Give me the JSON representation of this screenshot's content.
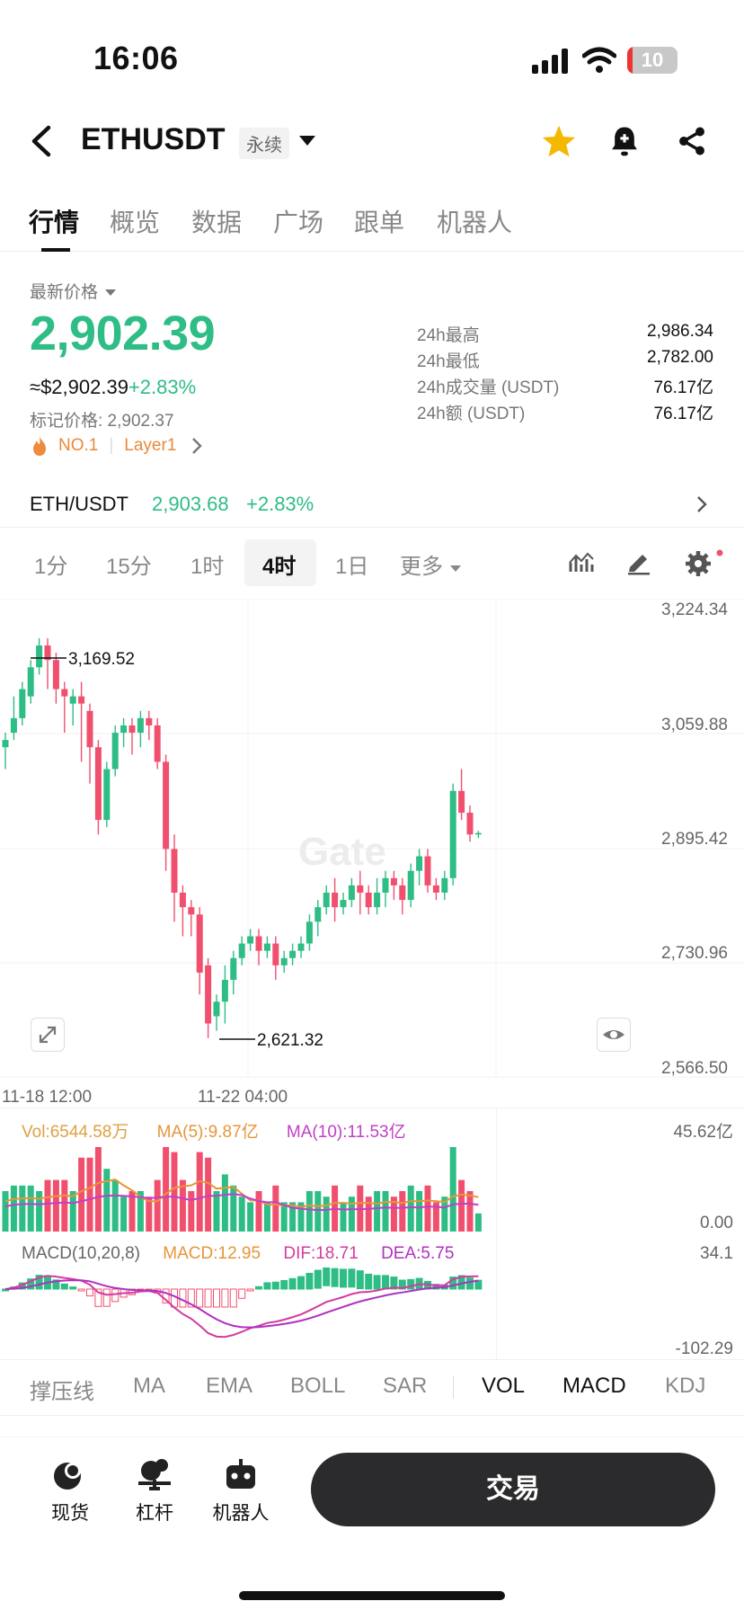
{
  "status_bar": {
    "time": "16:06",
    "battery": "10"
  },
  "header": {
    "back_icon": "back-chevron-icon",
    "symbol": "ETHUSDT",
    "contract_tag": "永续",
    "favorite_icon": "star-icon",
    "alert_icon": "bell-plus-icon",
    "share_icon": "share-icon",
    "favorite_color": "#f5b800"
  },
  "tabs": [
    {
      "label": "行情",
      "active": true
    },
    {
      "label": "概览",
      "active": false
    },
    {
      "label": "数据",
      "active": false
    },
    {
      "label": "广场",
      "active": false
    },
    {
      "label": "跟单",
      "active": false
    },
    {
      "label": "机器人",
      "active": false
    }
  ],
  "price": {
    "label": "最新价格",
    "last": "2,902.39",
    "usd": "≈$2,902.39",
    "change": "+2.83%",
    "mark_price": "标记价格: 2,902.37",
    "rank_tag": "NO.1",
    "category_tag": "Layer1"
  },
  "stats": [
    {
      "label": "24h最高",
      "value": "2,986.34"
    },
    {
      "label": "24h最低",
      "value": "2,782.00"
    },
    {
      "label": "24h成交量 (USDT)",
      "value": "76.17亿"
    },
    {
      "label": "24h额 (USDT)",
      "value": "76.17亿"
    }
  ],
  "spot_pair": {
    "pair": "ETH/USDT",
    "price": "2,903.68",
    "change": "+2.83%"
  },
  "intervals": [
    {
      "label": "1分",
      "selected": false
    },
    {
      "label": "15分",
      "selected": false
    },
    {
      "label": "1时",
      "selected": false
    },
    {
      "label": "4时",
      "selected": true
    },
    {
      "label": "1日",
      "selected": false
    },
    {
      "label": "更多",
      "selected": false
    }
  ],
  "chart_data": {
    "type": "candlestick",
    "timeframe": "4时",
    "price_axis": [
      "3,224.34",
      "3,059.88",
      "2,895.42",
      "2,730.96",
      "2,566.50"
    ],
    "ylim": [
      2566.5,
      3224.34
    ],
    "time_axis": [
      "11-18 12:00",
      "11-22 04:00"
    ],
    "high_marker": "3,169.52",
    "low_marker": "2,621.32",
    "watermark": "Gate",
    "colors": {
      "up": "#2ebd85",
      "down": "#f0506e"
    },
    "candles": [
      [
        3020,
        3030,
        2990,
        3040
      ],
      [
        3040,
        3060,
        3030,
        3090
      ],
      [
        3060,
        3100,
        3050,
        3110
      ],
      [
        3090,
        3130,
        3080,
        3140
      ],
      [
        3130,
        3160,
        3120,
        3170
      ],
      [
        3160,
        3140,
        3100,
        3170
      ],
      [
        3140,
        3100,
        3080,
        3150
      ],
      [
        3100,
        3090,
        3040,
        3110
      ],
      [
        3080,
        3090,
        3050,
        3100
      ],
      [
        3090,
        3080,
        3000,
        3110
      ],
      [
        3070,
        3020,
        2970,
        3080
      ],
      [
        3020,
        2920,
        2900,
        3030
      ],
      [
        2920,
        2990,
        2910,
        3000
      ],
      [
        2990,
        3040,
        2980,
        3050
      ],
      [
        3040,
        3050,
        3020,
        3060
      ],
      [
        3050,
        3040,
        3010,
        3060
      ],
      [
        3040,
        3060,
        3020,
        3070
      ],
      [
        3060,
        3050,
        3030,
        3070
      ],
      [
        3050,
        3000,
        2990,
        3060
      ],
      [
        3000,
        2880,
        2850,
        3010
      ],
      [
        2880,
        2820,
        2780,
        2900
      ],
      [
        2820,
        2800,
        2760,
        2830
      ],
      [
        2800,
        2790,
        2760,
        2810
      ],
      [
        2790,
        2710,
        2680,
        2800
      ],
      [
        2720,
        2640,
        2620,
        2730
      ],
      [
        2650,
        2670,
        2630,
        2680
      ],
      [
        2670,
        2700,
        2640,
        2720
      ],
      [
        2700,
        2730,
        2680,
        2740
      ],
      [
        2730,
        2750,
        2720,
        2760
      ],
      [
        2750,
        2760,
        2740,
        2770
      ],
      [
        2760,
        2740,
        2720,
        2770
      ],
      [
        2740,
        2750,
        2730,
        2760
      ],
      [
        2750,
        2720,
        2700,
        2760
      ],
      [
        2720,
        2730,
        2710,
        2740
      ],
      [
        2730,
        2740,
        2720,
        2750
      ],
      [
        2740,
        2750,
        2730,
        2760
      ],
      [
        2750,
        2780,
        2740,
        2790
      ],
      [
        2780,
        2800,
        2760,
        2810
      ],
      [
        2800,
        2820,
        2790,
        2830
      ],
      [
        2820,
        2800,
        2780,
        2840
      ],
      [
        2800,
        2810,
        2790,
        2820
      ],
      [
        2810,
        2830,
        2800,
        2840
      ],
      [
        2830,
        2820,
        2790,
        2850
      ],
      [
        2820,
        2800,
        2790,
        2830
      ],
      [
        2800,
        2820,
        2790,
        2840
      ],
      [
        2820,
        2840,
        2800,
        2850
      ],
      [
        2840,
        2830,
        2810,
        2850
      ],
      [
        2830,
        2810,
        2790,
        2840
      ],
      [
        2810,
        2850,
        2800,
        2860
      ],
      [
        2850,
        2870,
        2830,
        2880
      ],
      [
        2870,
        2830,
        2820,
        2880
      ],
      [
        2830,
        2820,
        2810,
        2840
      ],
      [
        2820,
        2840,
        2810,
        2850
      ],
      [
        2840,
        2960,
        2830,
        2970
      ],
      [
        2960,
        2930,
        2920,
        2990
      ],
      [
        2930,
        2900,
        2890,
        2940
      ],
      [
        2900,
        2902,
        2895,
        2905
      ]
    ]
  },
  "volume_pane": {
    "vol": "Vol:6544.58万",
    "ma5": "MA(5):9.87亿",
    "ma10": "MA(10):11.53亿",
    "axis_top": "45.62亿",
    "axis_bottom": "0.00",
    "color_vol": "#e0a040",
    "color_ma5": "#e8953a",
    "color_ma10": "#c040c8"
  },
  "macd_pane": {
    "title": "MACD(10,20,8)",
    "macd": "MACD:12.95",
    "dif": "DIF:18.71",
    "dea": "DEA:5.75",
    "axis_top": "34.1",
    "axis_bottom": "-102.29"
  },
  "indicators": [
    {
      "label": "撑压线",
      "on": false
    },
    {
      "label": "MA",
      "on": false
    },
    {
      "label": "EMA",
      "on": false
    },
    {
      "label": "BOLL",
      "on": false
    },
    {
      "label": "SAR",
      "on": false
    },
    {
      "label": "VOL",
      "on": true
    },
    {
      "label": "MACD",
      "on": true
    },
    {
      "label": "KDJ",
      "on": false
    }
  ],
  "bottom_nav": [
    {
      "label": "现货",
      "icon": "spot-icon"
    },
    {
      "label": "杠杆",
      "icon": "leverage-icon"
    },
    {
      "label": "机器人",
      "icon": "robot-icon"
    }
  ],
  "trade_button": "交易"
}
